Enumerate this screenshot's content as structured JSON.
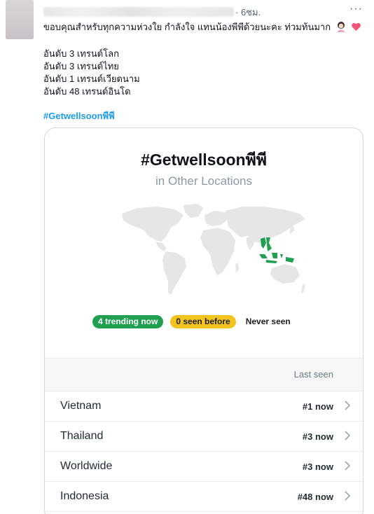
{
  "tweet": {
    "time": "· 6ชม.",
    "more_label": "···",
    "text_line1": "ขอบคุณสำหรับทุกความห่วงใย กำลังใจ แทนน้องพีพีด้วยนะคะ ท่วมท้นมาก",
    "stats": [
      "อันดับ 3 เทรนด์โลก",
      "อันดับ 3 เทรนด์ไทย",
      "อันดับ 1 เทรนด์เวียดนาม",
      "อันดับ 48 เทรนด์อินโด"
    ],
    "hashtag": "#Getwellsoonพีพี"
  },
  "card": {
    "title": "#Getwellsoonพีพี",
    "subtitle": "in Other Locations",
    "legend": {
      "trending": "4 trending now",
      "seen_before": "0 seen before",
      "never_seen": "Never seen"
    },
    "table_header": "Last seen",
    "rows": [
      {
        "name": "Vietnam",
        "rank": "#1 now"
      },
      {
        "name": "Thailand",
        "rank": "#3 now"
      },
      {
        "name": "Worldwide",
        "rank": "#3 now"
      },
      {
        "name": "Indonesia",
        "rank": "#48 now"
      }
    ]
  },
  "colors": {
    "trending": "#1f9f4f",
    "seen_before": "#f2c41d",
    "hashtag": "#1d9bf0",
    "map_land": "#e6e6e6"
  },
  "icons": [
    "more-icon",
    "woman-emoji-icon",
    "heart-emoji-icon",
    "chevron-right-icon"
  ]
}
